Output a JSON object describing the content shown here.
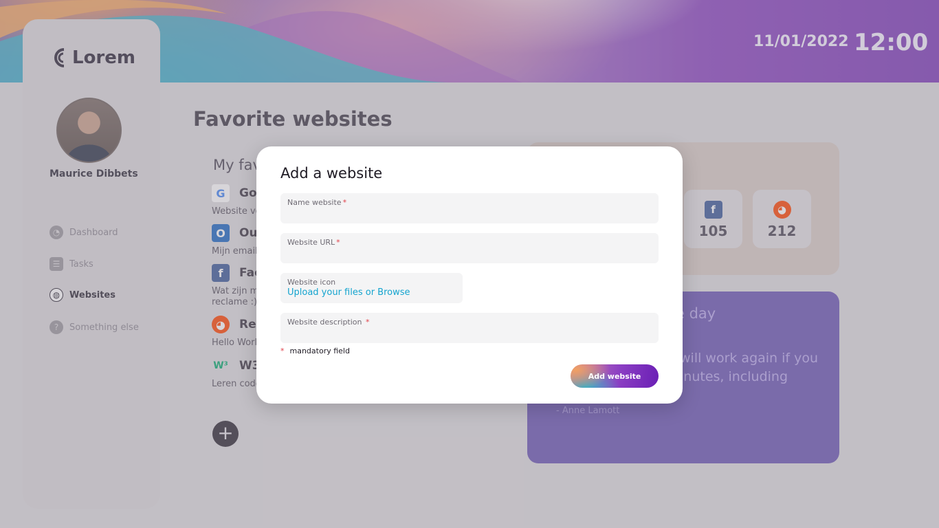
{
  "header": {
    "date": "11/01/2022",
    "time": "12:00"
  },
  "sidebar": {
    "logo": "Lorem",
    "user_name": "Maurice Dibbets",
    "items": [
      {
        "label": "Dashboard",
        "icon": "pie-chart-icon"
      },
      {
        "label": "Tasks",
        "icon": "checklist-icon"
      },
      {
        "label": "Websites",
        "icon": "globe-icon",
        "active": true
      },
      {
        "label": "Something else",
        "icon": "question-icon"
      }
    ]
  },
  "main": {
    "page_title": "Favorite websites",
    "section_title": "My fav",
    "favorites": [
      {
        "name": "Goo",
        "description": "Website vo",
        "icon": "google-icon"
      },
      {
        "name": "Ou",
        "description": "Mijn email",
        "icon": "outlook-icon"
      },
      {
        "name": "Fac",
        "description": "Wat zijn mi\nreclame :)",
        "icon": "facebook-icon"
      },
      {
        "name": "Red",
        "description": "Hello World",
        "icon": "reddit-icon"
      },
      {
        "name": "W3",
        "description": "Leren code",
        "icon": "w3schools-icon"
      }
    ],
    "add_icon": "plus-icon"
  },
  "stats": {
    "tiles": [
      {
        "icon": "facebook-icon",
        "value": "105",
        "color": "#3b5998"
      },
      {
        "icon": "reddit-icon",
        "value": "212",
        "color": "#ff4500"
      }
    ]
  },
  "quote": {
    "title": "e day",
    "text": "will work again if you\ninutes, including",
    "author": "- Anne Lamott"
  },
  "modal": {
    "title": "Add a website",
    "fields": {
      "name_label": "Name website",
      "url_label": "Website URL",
      "icon_label": "Website icon",
      "upload_link": "Upload your files or Browse",
      "description_label": "Website description"
    },
    "required_mark": "*",
    "mandatory_note": "mandatory field",
    "submit_label": "Add website"
  }
}
